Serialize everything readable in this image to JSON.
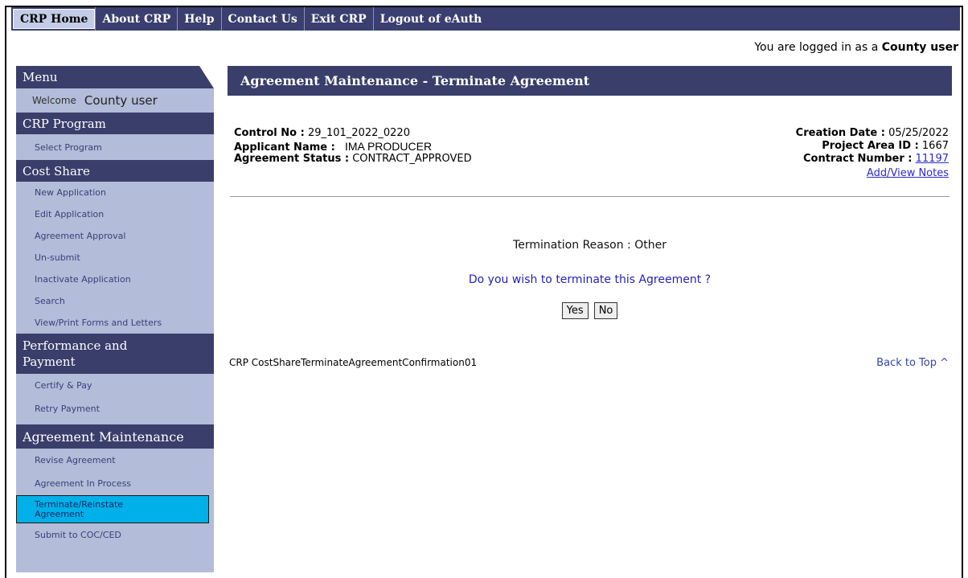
{
  "topnav": {
    "items": [
      "CRP Home",
      "About CRP",
      "Help",
      "Contact Us",
      "Exit CRP",
      "Logout of eAuth"
    ]
  },
  "login": {
    "prefix": "You are logged in as a",
    "role": "County user"
  },
  "sidebar": {
    "menu_title": "Menu",
    "welcome_label": "Welcome",
    "welcome_name": "County user",
    "crp_program": {
      "title": "CRP Program",
      "items": [
        "Select Program"
      ]
    },
    "cost_share": {
      "title": "Cost Share",
      "items": [
        "New Application",
        "Edit Application",
        "Agreement Approval",
        "Un-submit",
        "Inactivate Application",
        "Search",
        "View/Print Forms and Letters"
      ]
    },
    "performance": {
      "title_line1": "Performance and",
      "title_line2": "Payment",
      "items": [
        "Certify & Pay",
        "Retry Payment"
      ]
    },
    "agreement_maintenance": {
      "title": "Agreement Maintenance",
      "items": [
        "Revise Agreement",
        "Agreement In Process"
      ],
      "selected_line1": "Terminate/Reinstate",
      "selected_line2": "Agreement",
      "last_item": "Submit to COC/CED"
    }
  },
  "main": {
    "title": "Agreement Maintenance - Terminate Agreement",
    "control_no_label": "Control No :",
    "control_no": "29_101_2022_0220",
    "applicant_label": "Applicant Name :",
    "applicant": "IMA PRODUCER",
    "status_label": "Agreement Status :",
    "status": "CONTRACT_APPROVED",
    "creation_label": "Creation Date :",
    "creation_date": "05/25/2022",
    "project_label": "Project Area ID :",
    "project_id": "1667",
    "contract_label": "Contract Number :",
    "contract_number": "11197",
    "notes_link": "Add/View Notes",
    "reason_text": "Termination Reason : Other",
    "question": "Do you wish to terminate this Agreement ?",
    "yes_label": "Yes",
    "no_label": "No",
    "page_id": "CRP CostShareTerminateAgreementConfirmation01",
    "back_to_top": "Back to Top ^"
  },
  "colors": {
    "nav": "#3a3f70",
    "sidebar": "#b3bcd8",
    "selected": "#00b0e8",
    "link": "#2a2acc"
  }
}
